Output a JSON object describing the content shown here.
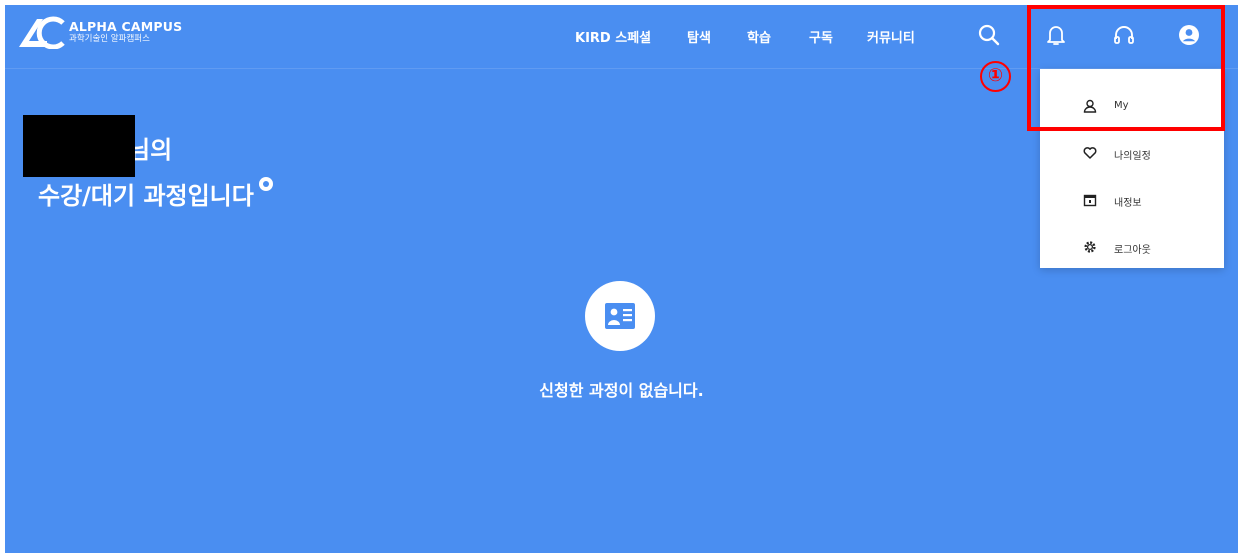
{
  "brand": {
    "title": "ALPHA CAMPUS",
    "subtitle": "과학기술인 알파캠퍼스"
  },
  "nav": [
    {
      "label": "KIRD 스페셜"
    },
    {
      "label": "탐색"
    },
    {
      "label": "학습"
    },
    {
      "label": "구독"
    },
    {
      "label": "커뮤니티"
    }
  ],
  "header_icons": [
    "search-icon",
    "bell-icon",
    "headset-icon",
    "user-circle-icon"
  ],
  "greeting": {
    "line1_suffix": "님의",
    "line2": "수강/대기 과정입니다"
  },
  "empty_state": {
    "message": "신청한 과정이 없습니다."
  },
  "dropdown": {
    "items": [
      {
        "label": "My",
        "icon": "user-icon"
      },
      {
        "label": "나의일정",
        "icon": "heart-icon"
      },
      {
        "label": "내정보",
        "icon": "calendar-icon"
      },
      {
        "label": "로그아웃",
        "icon": "gear-icon"
      }
    ]
  },
  "annotation": {
    "marker": "①",
    "color": "#ff0000"
  },
  "colors": {
    "background": "#4a8ef1",
    "text": "#ffffff",
    "dropdown_bg": "#ffffff"
  }
}
